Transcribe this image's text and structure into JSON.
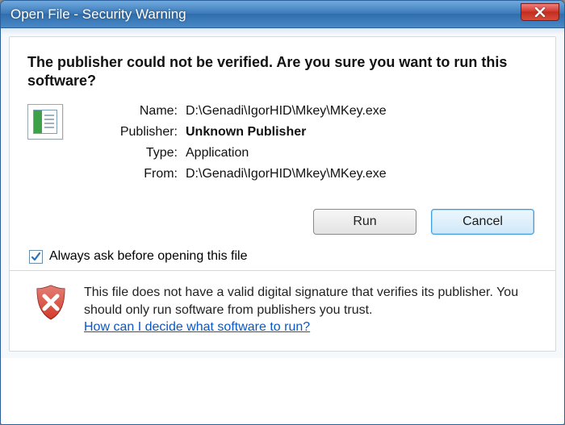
{
  "window": {
    "title": "Open File - Security Warning"
  },
  "dialog": {
    "heading": "The publisher could not be verified.  Are you sure you want to run this software?",
    "fields": {
      "name_label": "Name:",
      "name_value": "D:\\Genadi\\IgorHID\\Mkey\\MKey.exe",
      "publisher_label": "Publisher:",
      "publisher_value": "Unknown Publisher",
      "type_label": "Type:",
      "type_value": "Application",
      "from_label": "From:",
      "from_value": "D:\\Genadi\\IgorHID\\Mkey\\MKey.exe"
    },
    "buttons": {
      "run": "Run",
      "cancel": "Cancel"
    },
    "checkbox": {
      "label": "Always ask before opening this file",
      "checked": true
    },
    "footer": {
      "text": "This file does not have a valid digital signature that verifies its publisher.  You should only run software from publishers you trust.",
      "link": "How can I decide what software to run?"
    }
  }
}
